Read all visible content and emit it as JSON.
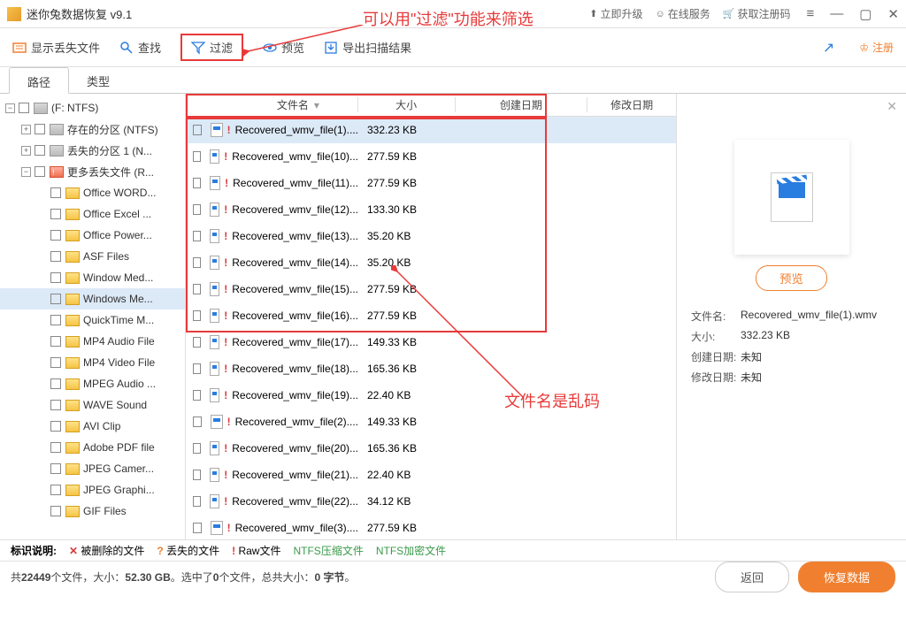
{
  "titlebar": {
    "title": "迷你兔数据恢复 v9.1",
    "links": {
      "upgrade": "立即升级",
      "online": "在线服务",
      "getcode": "获取注册码"
    }
  },
  "toolbar": {
    "showlost": "显示丢失文件",
    "find": "查找",
    "filter": "过滤",
    "preview": "预览",
    "export": "导出扫描结果",
    "register": "注册"
  },
  "tabs": {
    "path": "路径",
    "type": "类型"
  },
  "tree": {
    "root": "(F: NTFS)",
    "items": [
      {
        "label": "存在的分区 (NTFS)",
        "ico": "disk",
        "ind": 1,
        "tog": "+"
      },
      {
        "label": "丢失的分区 1 (N...",
        "ico": "disk",
        "ind": 1,
        "tog": "+"
      },
      {
        "label": "更多丢失文件 (R...",
        "ico": "folder-r",
        "ind": 1,
        "tog": "−"
      },
      {
        "label": "Office WORD...",
        "ico": "folder-y",
        "ind": 2
      },
      {
        "label": "Office Excel ...",
        "ico": "folder-y",
        "ind": 2
      },
      {
        "label": "Office Power...",
        "ico": "folder-y",
        "ind": 2
      },
      {
        "label": "ASF Files",
        "ico": "folder-y",
        "ind": 2
      },
      {
        "label": "Window Med...",
        "ico": "folder-y",
        "ind": 2
      },
      {
        "label": "Windows Me...",
        "ico": "folder-y",
        "ind": 2,
        "sel": true
      },
      {
        "label": "QuickTime M...",
        "ico": "folder-y",
        "ind": 2
      },
      {
        "label": "MP4 Audio File",
        "ico": "folder-y",
        "ind": 2
      },
      {
        "label": "MP4 Video File",
        "ico": "folder-y",
        "ind": 2
      },
      {
        "label": "MPEG Audio ...",
        "ico": "folder-y",
        "ind": 2
      },
      {
        "label": "WAVE Sound",
        "ico": "folder-y",
        "ind": 2
      },
      {
        "label": "AVI Clip",
        "ico": "folder-y",
        "ind": 2
      },
      {
        "label": "Adobe PDF file",
        "ico": "folder-y",
        "ind": 2
      },
      {
        "label": "JPEG Camer...",
        "ico": "folder-y",
        "ind": 2
      },
      {
        "label": "JPEG Graphi...",
        "ico": "folder-y",
        "ind": 2
      },
      {
        "label": "GIF Files",
        "ico": "folder-y",
        "ind": 2
      }
    ]
  },
  "columns": {
    "name": "文件名",
    "size": "大小",
    "cdate": "创建日期",
    "mdate": "修改日期"
  },
  "files": [
    {
      "name": "Recovered_wmv_file(1)....",
      "size": "332.23 KB",
      "sel": true
    },
    {
      "name": "Recovered_wmv_file(10)...",
      "size": "277.59 KB"
    },
    {
      "name": "Recovered_wmv_file(11)...",
      "size": "277.59 KB"
    },
    {
      "name": "Recovered_wmv_file(12)...",
      "size": "133.30 KB"
    },
    {
      "name": "Recovered_wmv_file(13)...",
      "size": "35.20 KB"
    },
    {
      "name": "Recovered_wmv_file(14)...",
      "size": "35.20 KB"
    },
    {
      "name": "Recovered_wmv_file(15)...",
      "size": "277.59 KB"
    },
    {
      "name": "Recovered_wmv_file(16)...",
      "size": "277.59 KB"
    },
    {
      "name": "Recovered_wmv_file(17)...",
      "size": "149.33 KB"
    },
    {
      "name": "Recovered_wmv_file(18)...",
      "size": "165.36 KB"
    },
    {
      "name": "Recovered_wmv_file(19)...",
      "size": "22.40 KB"
    },
    {
      "name": "Recovered_wmv_file(2)....",
      "size": "149.33 KB"
    },
    {
      "name": "Recovered_wmv_file(20)...",
      "size": "165.36 KB"
    },
    {
      "name": "Recovered_wmv_file(21)...",
      "size": "22.40 KB"
    },
    {
      "name": "Recovered_wmv_file(22)...",
      "size": "34.12 KB"
    },
    {
      "name": "Recovered_wmv_file(3)....",
      "size": "277.59 KB"
    }
  ],
  "preview": {
    "btn": "预览",
    "name_lbl": "文件名:",
    "name": "Recovered_wmv_file(1).wmv",
    "size_lbl": "大小:",
    "size": "332.23 KB",
    "cdate_lbl": "创建日期:",
    "cdate": "未知",
    "mdate_lbl": "修改日期:",
    "mdate": "未知"
  },
  "legend": {
    "title": "标识说明:",
    "deleted": "被删除的文件",
    "lost": "丢失的文件",
    "raw": "Raw文件",
    "comp": "NTFS压缩文件",
    "enc": "NTFS加密文件"
  },
  "status": {
    "pre": "共",
    "count": "22449",
    "mid1": "个文件，大小：",
    "total": "52.30 GB",
    "mid2": "。选中了",
    "sel": "0",
    "mid3": "个文件，总共大小：",
    "selsize": "0 字节",
    "end": "。",
    "back": "返回",
    "recover": "恢复数据"
  },
  "annot": {
    "filter_tip": "可以用\"过滤\"功能来筛选",
    "garbled": "文件名是乱码"
  }
}
